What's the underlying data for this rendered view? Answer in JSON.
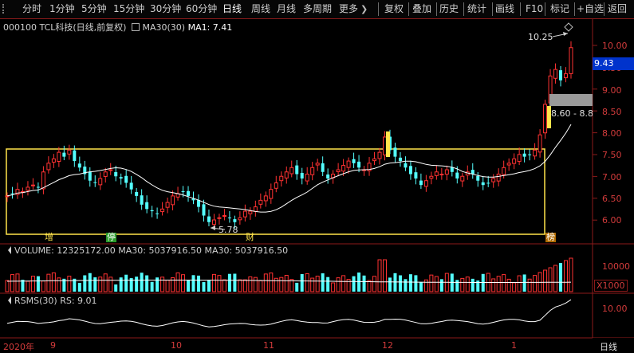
{
  "toolbar": {
    "periods": [
      "分时",
      "1分钟",
      "5分钟",
      "15分钟",
      "30分钟",
      "60分钟",
      "日线",
      "周线",
      "月线",
      "多周期",
      "更多"
    ],
    "active_period": "日线",
    "tools": [
      "复权",
      "叠加",
      "历史",
      "统计",
      "画线",
      "F10",
      "标记",
      "+自选",
      "返回"
    ]
  },
  "info": {
    "stock_code": "000100",
    "stock_name": "TCL科技",
    "mode": "(日线,前复权)",
    "ma_label": "MA30(30)",
    "ma_value": "MA1: 7.41"
  },
  "price_axis": {
    "ticks": [
      "10.00",
      "9.50",
      "9.00",
      "8.50",
      "8.00",
      "7.50",
      "7.00",
      "6.50",
      "6.00"
    ],
    "current_price": "9.43",
    "range_label": "8.60 - 8.8"
  },
  "annotations": {
    "high": "10.25",
    "low": "5.78",
    "marker_zeng": "增",
    "marker_ting": "停",
    "marker_cai": "财",
    "marker_bang": "榜"
  },
  "volume": {
    "label": "VOLUME: 12325172.00",
    "ma_a": "MA30: 5037916.50",
    "ma_b": "MA30: 5037916.50",
    "tick": "10000",
    "unit": "X1000"
  },
  "rsms": {
    "label": "RSMS(30)",
    "value": "RS: 9.01",
    "tick": "10.00"
  },
  "x_axis": {
    "labels": [
      "2020年",
      "9",
      "10",
      "11",
      "12",
      "1"
    ],
    "period": "日线"
  },
  "colors": {
    "up": "#ff3232",
    "down": "#54ffff",
    "box": "#ffe44b",
    "ma": "#ffffff",
    "grid_border": "#8b1a1a"
  }
}
